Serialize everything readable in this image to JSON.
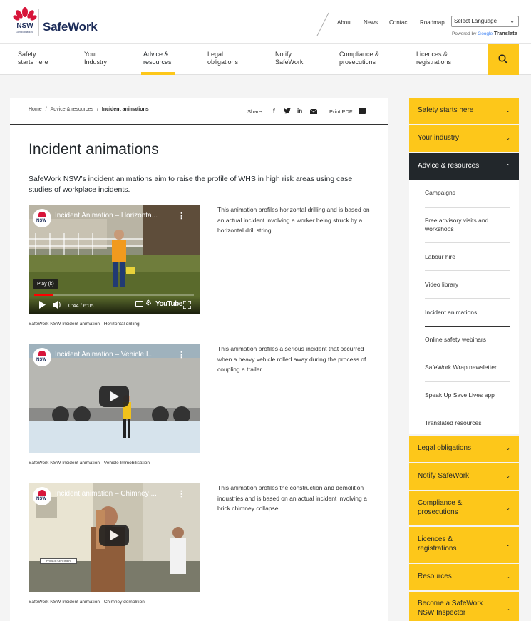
{
  "header": {
    "brand": "SafeWork",
    "logo_text": "NSW",
    "logo_sub": "GOVERNMENT",
    "utility_links": [
      "About",
      "News",
      "Contact",
      "Roadmap"
    ],
    "language_select": "Select Language",
    "powered_by": "Powered by",
    "google": "Google",
    "translate": "Translate"
  },
  "nav": {
    "items": [
      {
        "line1": "Safety",
        "line2": "starts here"
      },
      {
        "line1": "Your",
        "line2": "Industry"
      },
      {
        "line1": "Advice &",
        "line2": "resources"
      },
      {
        "line1": "Legal",
        "line2": "obligations"
      },
      {
        "line1": "Notify",
        "line2": "SafeWork"
      },
      {
        "line1": "Compliance &",
        "line2": "prosecutions"
      },
      {
        "line1": "Licences &",
        "line2": "registrations"
      }
    ]
  },
  "breadcrumb": [
    "Home",
    "Advice & resources",
    "Incident animations"
  ],
  "share": {
    "label": "Share",
    "print": "Print PDF"
  },
  "page": {
    "title": "Incident animations",
    "intro": "SafeWork NSW’s incident animations aim to raise the profile of WHS in high risk areas using case studies of workplace incidents."
  },
  "videos": [
    {
      "title": "Incident Animation – Horizonta...",
      "caption": "SafeWork NSW Incident animation - Horizontal drilling",
      "description": "This animation profiles horizontal drilling and is based on an actual incident involving a worker being struck by a horizontal drill string.",
      "tooltip": "Play (k)",
      "time": "0:44 / 6:05",
      "youtube": "YouTube",
      "progress": 0.12
    },
    {
      "title": "Incident Animation – Vehicle I...",
      "caption": "SafeWork NSW Incident animation - Vehicle Immobilisation",
      "description": "This animation profiles a serious incident that occurred when a heavy vehicle rolled away during the process of coupling a trailer."
    },
    {
      "title": "Incident animation – Chimney ...",
      "caption": "SafeWork NSW Incident animation - Chimney demolition",
      "description": "This animation profiles the construction and demolition industries and is based on an actual incident involving a brick chimney collapse.",
      "sign": "PRIVATE CERTIFIER"
    }
  ],
  "sidebar": {
    "top": [
      "Safety starts here",
      "Your industry",
      "Advice & resources"
    ],
    "sub": [
      "Campaigns",
      "Free advisory visits and workshops",
      "Labour hire",
      "Video library",
      "Incident animations",
      "Online safety webinars",
      "SafeWork Wrap newsletter",
      "Speak Up Save Lives app",
      "Translated resources"
    ],
    "bottom": [
      "Legal obligations",
      "Notify SafeWork",
      "Compliance & prosecutions",
      "Licences & registrations",
      "Resources",
      "Become a SafeWork NSW Inspector"
    ]
  },
  "colors": {
    "accent": "#fdc71a",
    "dark": "#22272b",
    "navy": "#1b2b58",
    "nsw_red": "#d7153a"
  }
}
